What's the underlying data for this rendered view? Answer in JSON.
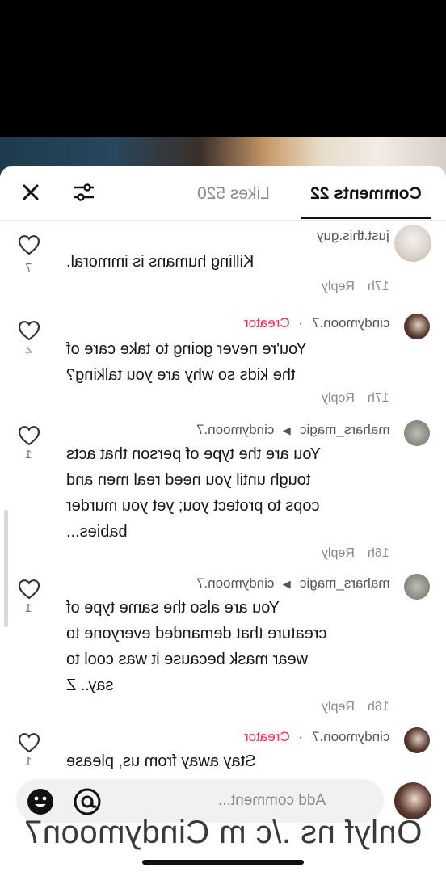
{
  "header": {
    "comments_tab": "Comments 22",
    "likes_tab": "Likes 520"
  },
  "icons": {
    "close": "close-icon",
    "filter": "sliders-icon",
    "heart": "heart-outline-icon",
    "emoji": "emoji-icon",
    "mention": "at-icon"
  },
  "comments": [
    {
      "username": "just.this.guy",
      "text": "Killing humans is immoral.",
      "time": "17h",
      "reply": "Reply",
      "likes": "7"
    },
    {
      "username": "cindymoon.7",
      "creator": "Creator",
      "text": "You're never going to take care of\nthe kids so why are you talking?",
      "time": "17h",
      "reply": "Reply",
      "likes": "4"
    },
    {
      "username": "mahars_magic",
      "reply_to": "cindymoon.7",
      "text": "You are the type of person that acts\ntough until you need real men and\ncops to protect you; yet you murder\nbabies...",
      "time": "16h",
      "reply": "Reply",
      "likes": "1"
    },
    {
      "username": "mahars_magic",
      "reply_to": "cindymoon.7",
      "text": "You are also the same type of\ncreature that demanded everyone to\nwear mask because it was cool to\nsay.. Z",
      "time": "16h",
      "reply": "Reply",
      "likes": "1"
    },
    {
      "username": "cindymoon.7",
      "creator": "Creator",
      "text": "Stay away from us, please",
      "likes": "1"
    }
  ],
  "composer": {
    "placeholder": "Add comment..."
  },
  "watermark": "Onlyf ns ./c m Cindymoon7",
  "colors": {
    "accent": "#fe2c55",
    "panel": "#ffffff"
  }
}
